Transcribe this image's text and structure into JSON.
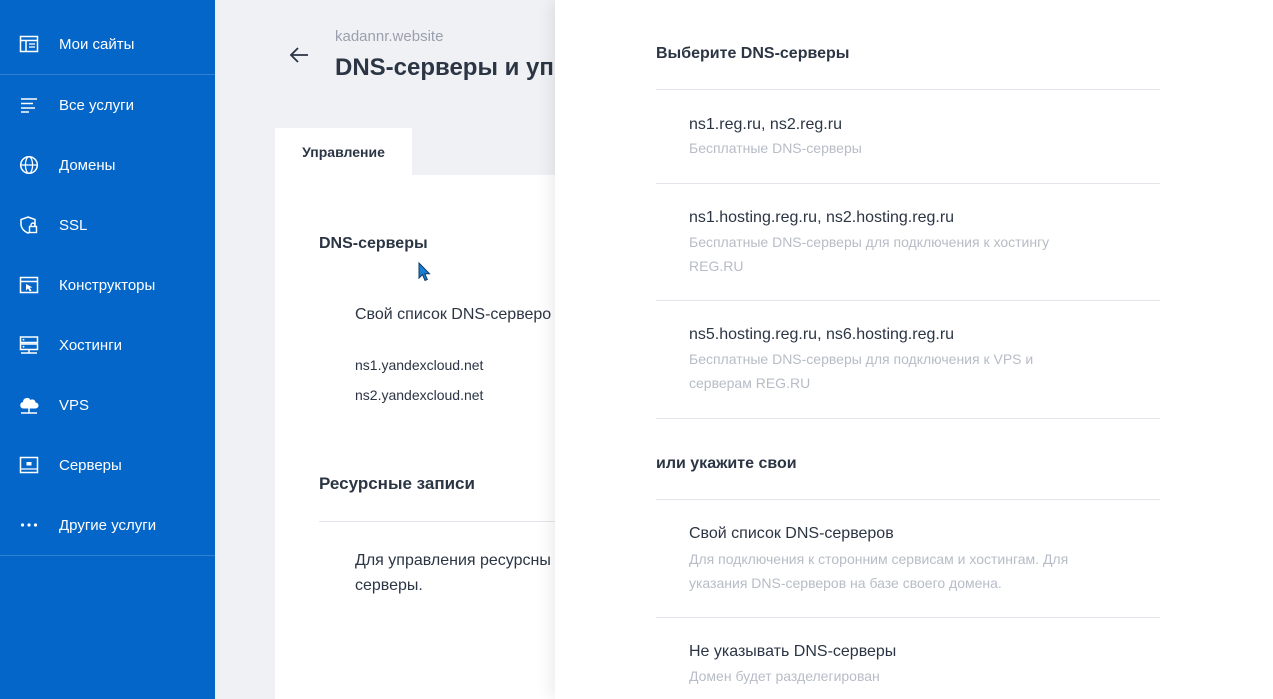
{
  "sidebar": {
    "items": [
      {
        "label": "Мои сайты",
        "icon": "sites-icon"
      },
      {
        "label": "Все услуги",
        "icon": "list-icon"
      },
      {
        "label": "Домены",
        "icon": "globe-icon"
      },
      {
        "label": "SSL",
        "icon": "shield-lock-icon"
      },
      {
        "label": "Конструкторы",
        "icon": "builder-icon"
      },
      {
        "label": "Хостинги",
        "icon": "hosting-icon"
      },
      {
        "label": "VPS",
        "icon": "vps-icon"
      },
      {
        "label": "Серверы",
        "icon": "server-icon"
      },
      {
        "label": "Другие услуги",
        "icon": "more-icon"
      }
    ]
  },
  "main": {
    "site_name": "kadannr.website",
    "title": "DNS-серверы и уп",
    "tab_active": "Управление",
    "dns_section_title": "DNS-серверы",
    "dns_own_list": "Свой список DNS-серверо",
    "ns": [
      "ns1.yandexcloud.net",
      "ns2.yandexcloud.net"
    ],
    "resource_title": "Ресурсные записи",
    "resource_text": "Для управления ресурсны серверы."
  },
  "panel": {
    "heading_choose": "Выберите DNS-серверы",
    "options": [
      {
        "title": "ns1.reg.ru, ns2.reg.ru",
        "desc": "Бесплатные DNS-серверы"
      },
      {
        "title": "ns1.hosting.reg.ru, ns2.hosting.reg.ru",
        "desc": "Бесплатные DNS-серверы для подключения к хостингу REG.RU"
      },
      {
        "title": "ns5.hosting.reg.ru, ns6.hosting.reg.ru",
        "desc": "Бесплатные DNS-серверы для подключения к VPS и серверам REG.RU"
      }
    ],
    "heading_custom": "или укажите свои",
    "custom_options": [
      {
        "title": "Свой список DNS-серверов",
        "desc": "Для подключения к сторонним сервисам и хостингам. Для указания DNS-серверов на базе своего домена."
      },
      {
        "title": "Не указывать DNS-серверы",
        "desc": "Домен будет разделегирован"
      }
    ]
  },
  "colors": {
    "sidebar": "#0466c8",
    "text": "#2b3544",
    "muted": "#b7bcc6"
  }
}
